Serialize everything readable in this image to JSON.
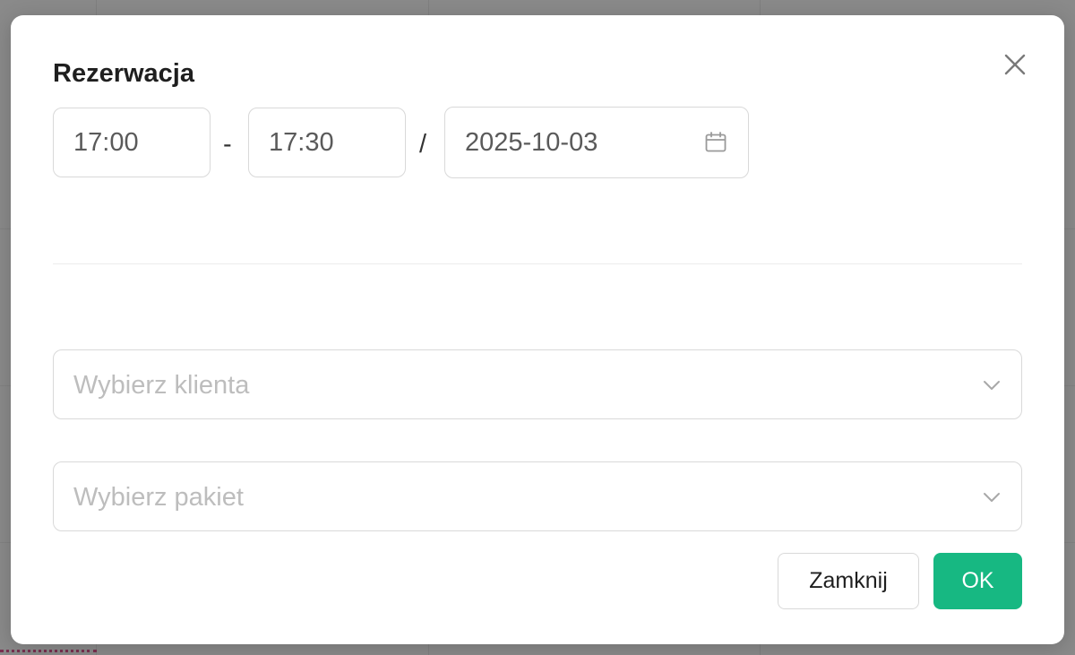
{
  "dialog": {
    "title": "Rezerwacja",
    "close_icon": "close-icon"
  },
  "time": {
    "start": "17:00",
    "separator": "-",
    "end": "17:30"
  },
  "date": {
    "separator": "/",
    "value": "2025-10-03",
    "icon": "calendar-icon"
  },
  "client_select": {
    "placeholder": "Wybierz klienta",
    "icon": "chevron-down-icon"
  },
  "package_select": {
    "placeholder": "Wybierz pakiet",
    "icon": "chevron-down-icon"
  },
  "buttons": {
    "close_label": "Zamknij",
    "ok_label": "OK"
  },
  "colors": {
    "primary": "#17b882",
    "border": "#d9d9d9",
    "placeholder": "#bdbdbd",
    "backdrop": "#8a8a8a"
  }
}
